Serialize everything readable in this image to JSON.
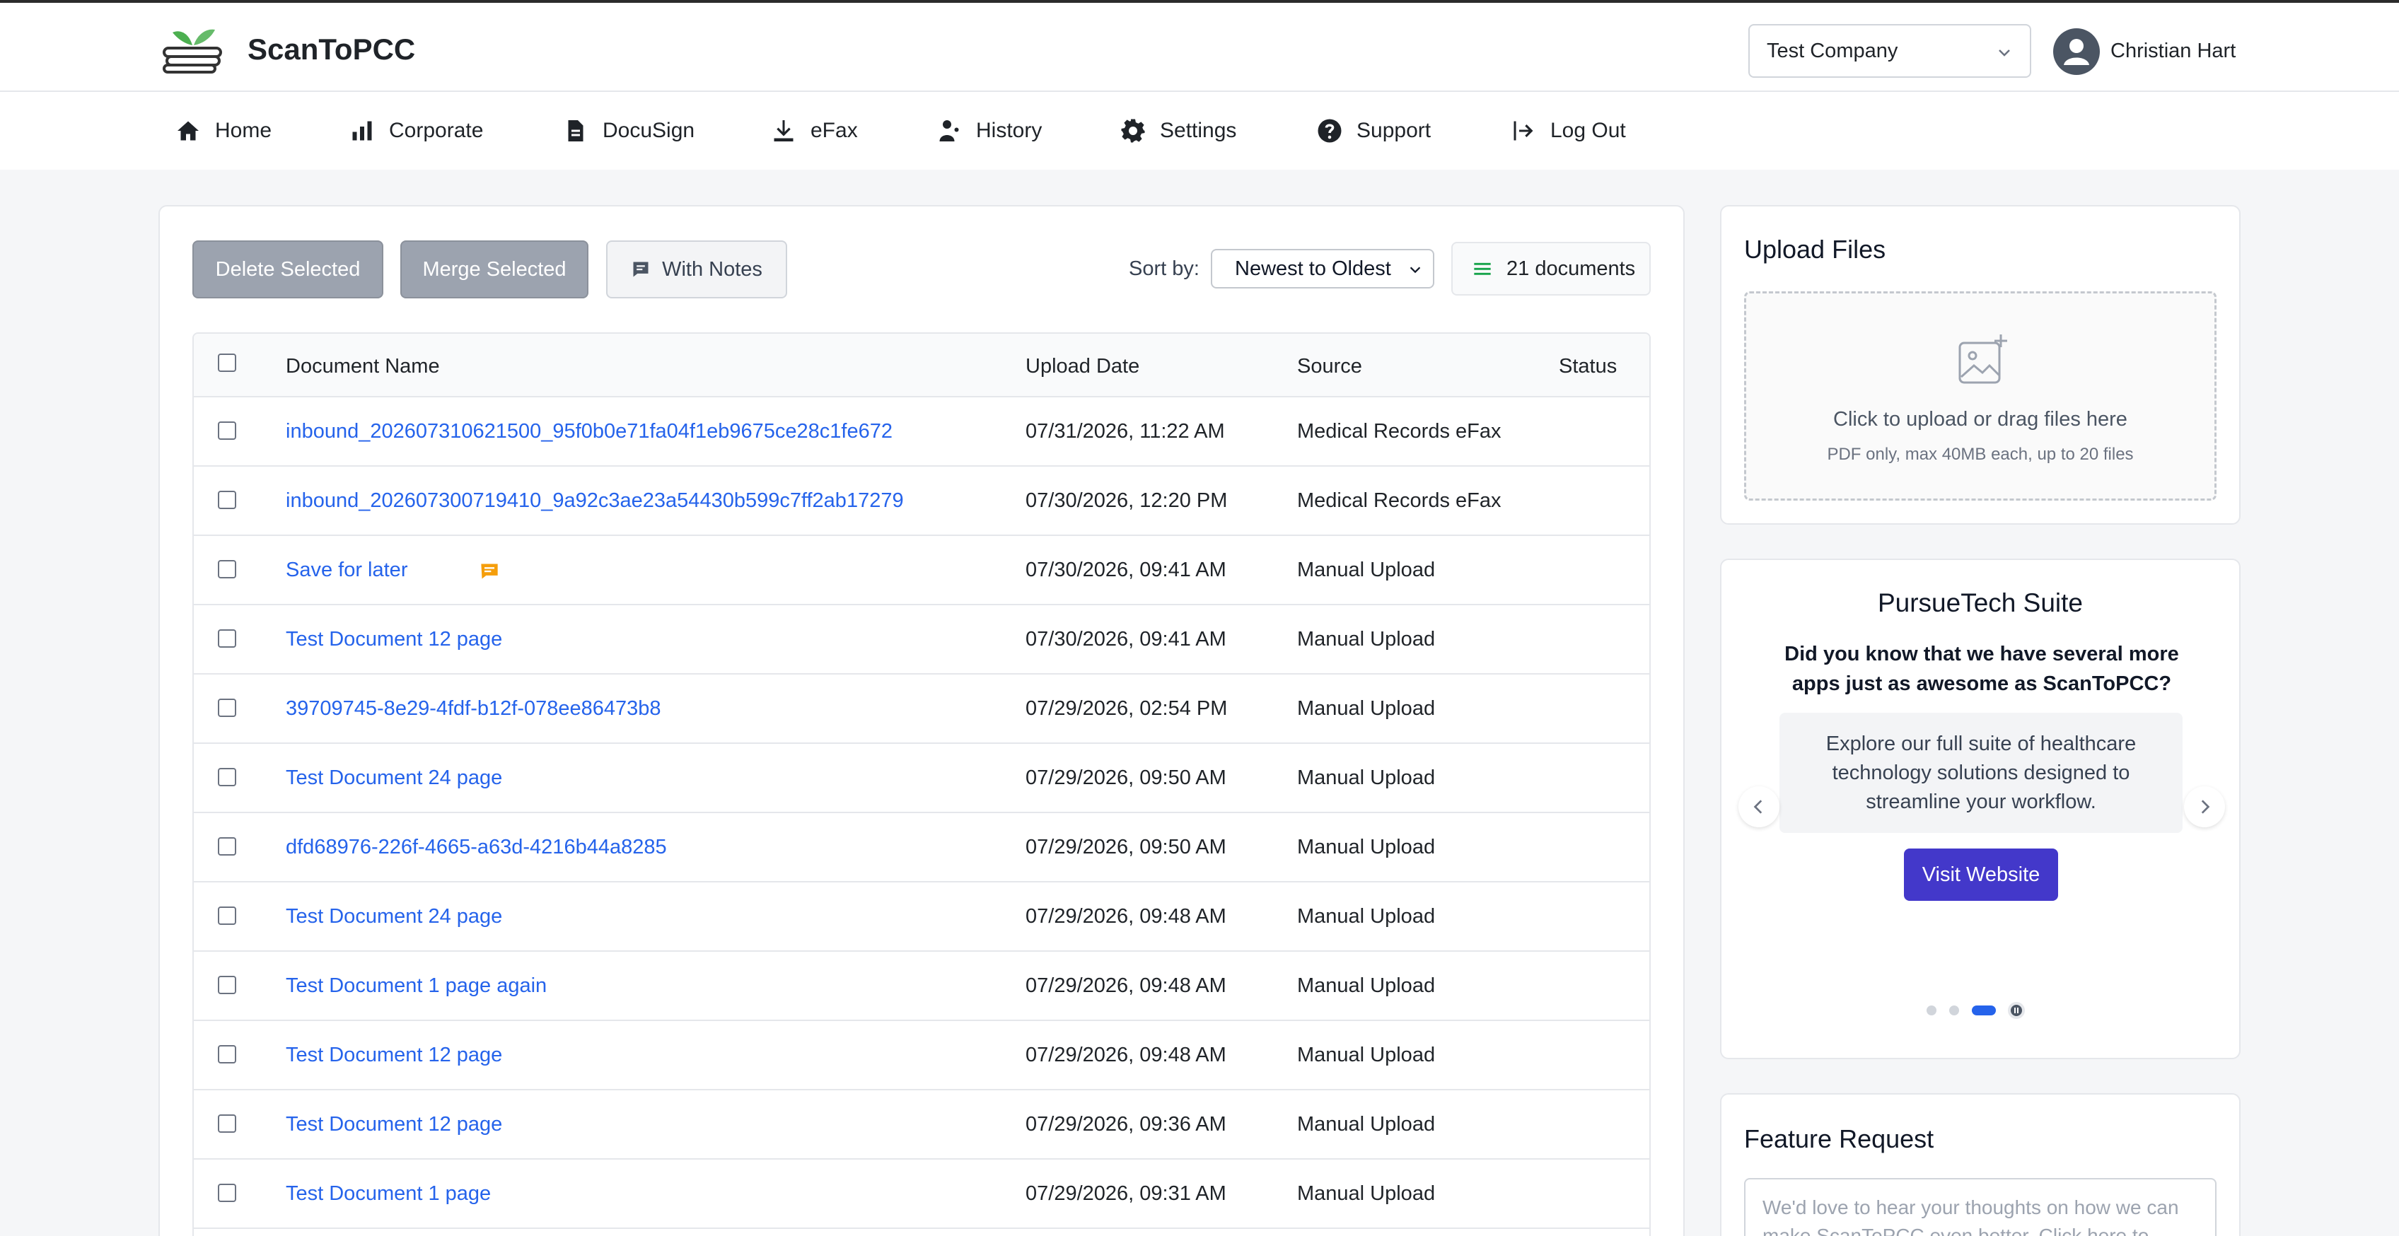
{
  "header": {
    "brand": "ScanToPCC",
    "company": "Test Company",
    "user_name": "Christian Hart"
  },
  "nav": [
    {
      "label": "Home",
      "icon": "home-icon"
    },
    {
      "label": "Corporate",
      "icon": "bar-chart-icon"
    },
    {
      "label": "DocuSign",
      "icon": "document-icon"
    },
    {
      "label": "eFax",
      "icon": "download-icon"
    },
    {
      "label": "History",
      "icon": "user-history-icon"
    },
    {
      "label": "Settings",
      "icon": "gear-icon"
    },
    {
      "label": "Support",
      "icon": "help-icon"
    },
    {
      "label": "Log Out",
      "icon": "logout-icon"
    }
  ],
  "toolbar": {
    "delete_label": "Delete Selected",
    "merge_label": "Merge Selected",
    "notes_label": "With Notes",
    "sort_label": "Sort by:",
    "sort_value": "Newest to Oldest",
    "doc_count": "21 documents"
  },
  "table": {
    "columns": [
      "Document Name",
      "Upload Date",
      "Source",
      "Status"
    ],
    "rows": [
      {
        "name": "inbound_202607310621500_95f0b0e71fa04f1eb9675ce28c1fe672",
        "date": "07/31/2026, 11:22 AM",
        "source": "Medical Records eFax",
        "status": "",
        "has_note": false
      },
      {
        "name": "inbound_202607300719410_9a92c3ae23a54430b599c7ff2ab17279",
        "date": "07/30/2026, 12:20 PM",
        "source": "Medical Records eFax",
        "status": "",
        "has_note": false
      },
      {
        "name": "Save for later",
        "date": "07/30/2026, 09:41 AM",
        "source": "Manual Upload",
        "status": "",
        "has_note": true
      },
      {
        "name": "Test Document 12 page",
        "date": "07/30/2026, 09:41 AM",
        "source": "Manual Upload",
        "status": "",
        "has_note": false
      },
      {
        "name": "39709745-8e29-4fdf-b12f-078ee86473b8",
        "date": "07/29/2026, 02:54 PM",
        "source": "Manual Upload",
        "status": "",
        "has_note": false
      },
      {
        "name": "Test Document 24 page",
        "date": "07/29/2026, 09:50 AM",
        "source": "Manual Upload",
        "status": "",
        "has_note": false
      },
      {
        "name": "dfd68976-226f-4665-a63d-4216b44a8285",
        "date": "07/29/2026, 09:50 AM",
        "source": "Manual Upload",
        "status": "",
        "has_note": false
      },
      {
        "name": "Test Document 24 page",
        "date": "07/29/2026, 09:48 AM",
        "source": "Manual Upload",
        "status": "",
        "has_note": false
      },
      {
        "name": "Test Document 1 page again",
        "date": "07/29/2026, 09:48 AM",
        "source": "Manual Upload",
        "status": "",
        "has_note": false
      },
      {
        "name": "Test Document 12 page",
        "date": "07/29/2026, 09:48 AM",
        "source": "Manual Upload",
        "status": "",
        "has_note": false
      },
      {
        "name": "Test Document 12 page",
        "date": "07/29/2026, 09:36 AM",
        "source": "Manual Upload",
        "status": "",
        "has_note": false
      },
      {
        "name": "Test Document 1 page",
        "date": "07/29/2026, 09:31 AM",
        "source": "Manual Upload",
        "status": "",
        "has_note": false
      }
    ]
  },
  "upload": {
    "title": "Upload Files",
    "main_text": "Click to upload or drag files here",
    "sub_text": "PDF only, max 40MB each, up to 20 files"
  },
  "promo": {
    "title": "PursueTech Suite",
    "question": "Did you know that we have several more apps just as awesome as ScanToPCC?",
    "body": "Explore our full suite of healthcare technology solutions designed to streamline your workflow.",
    "button": "Visit Website",
    "active_slide": 3,
    "slide_count": 4
  },
  "feature": {
    "title": "Feature Request",
    "placeholder": "We'd love to hear your thoughts on how we can make ScanToPCC even better. Click here to"
  },
  "colors": {
    "link": "#2563eb",
    "accent": "#4338ca",
    "disabled_button": "#9ca3af"
  }
}
